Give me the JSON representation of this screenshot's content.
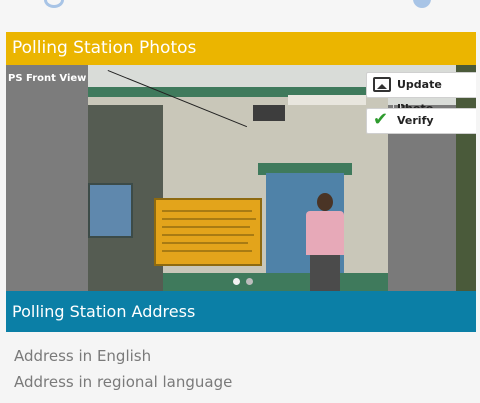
{
  "sections": {
    "photos_title": "Polling Station Photos",
    "address_title": "Polling Station Address"
  },
  "photo": {
    "label": "PS Front View",
    "update_button": "Update Photo",
    "verify_button": "Verify",
    "current_page": 1,
    "page_count": 2
  },
  "address": {
    "english_placeholder": "Address in English",
    "regional_placeholder": "Address in regional language"
  },
  "colors": {
    "photos_header": "#ebb500",
    "address_header": "#0b7fa6",
    "verify_check": "#2e9b2e"
  },
  "icons": [
    "sync-icon",
    "status-dot-icon",
    "photo-icon",
    "check-icon"
  ]
}
